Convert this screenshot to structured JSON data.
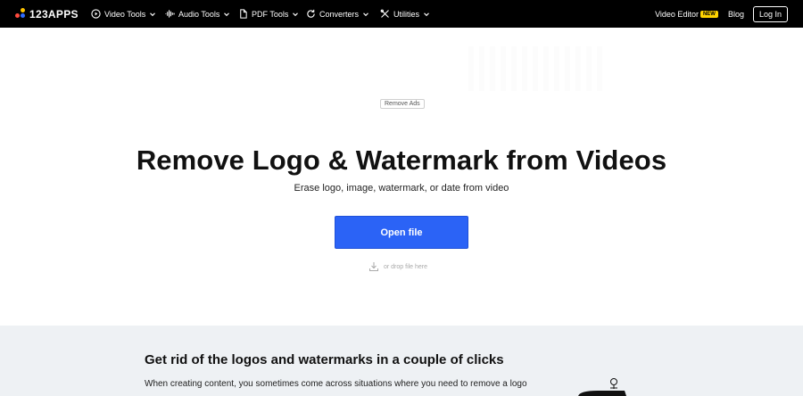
{
  "brand": {
    "name": "123APPS"
  },
  "nav": {
    "items": [
      {
        "label": "Video Tools",
        "icon": "play-circle-icon"
      },
      {
        "label": "Audio Tools",
        "icon": "waveform-icon"
      },
      {
        "label": "PDF Tools",
        "icon": "document-icon"
      },
      {
        "label": "Converters",
        "icon": "refresh-icon"
      },
      {
        "label": "Utilities",
        "icon": "tools-icon"
      }
    ],
    "video_editor": "Video Editor",
    "new_badge": "NEW",
    "blog": "Blog",
    "login": "Log In"
  },
  "ads": {
    "remove_label": "Remove Ads"
  },
  "hero": {
    "title": "Remove Logo & Watermark from Videos",
    "subtitle": "Erase logo, image, watermark, or date from video",
    "open_button": "Open file",
    "drop_hint": "or drop file here"
  },
  "info": {
    "title": "Get rid of the logos and watermarks in a couple of clicks",
    "text": "When creating content, you sometimes come across situations where you need to remove a logo"
  },
  "colors": {
    "topbar": "#000000",
    "accent": "#2b63f6",
    "badge": "#ffd400",
    "section_bg": "#eef1f4"
  }
}
